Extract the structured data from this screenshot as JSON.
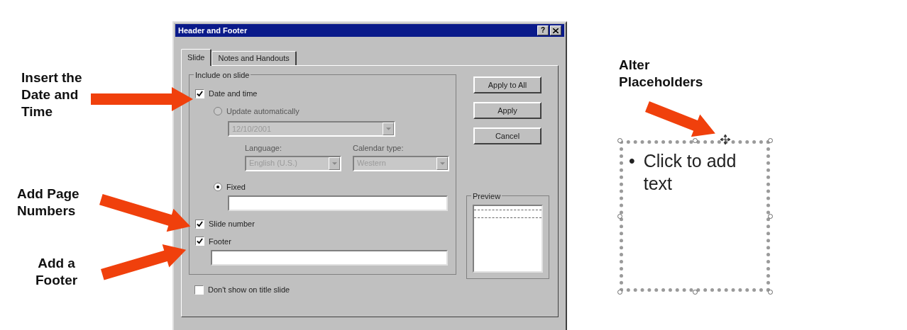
{
  "annotations": [
    {
      "kind": "left",
      "text": "Insert the\nDate and\nTime"
    },
    {
      "kind": "left",
      "text": "Add Page\nNumbers"
    },
    {
      "kind": "center",
      "text": "Add a\nFooter"
    },
    {
      "kind": "left",
      "text": "Alter\nPlaceholders"
    }
  ],
  "dialog": {
    "title": "Header and Footer",
    "help_button": "?",
    "tabs": [
      {
        "label": "Slide",
        "selected": true
      },
      {
        "label": "Notes and Handouts",
        "selected": false
      }
    ],
    "group_title": "Include on slide",
    "date_and_time": {
      "label": "Date and time",
      "checked": true
    },
    "update_automatically": {
      "label": "Update automatically",
      "selected": false,
      "disabled": true,
      "date": "12/10/2001",
      "language_label": "Language:",
      "language": "English (U.S.)",
      "calendar_label": "Calendar type:",
      "calendar": "Western"
    },
    "fixed": {
      "label": "Fixed",
      "selected": true
    },
    "slide_number": {
      "label": "Slide number",
      "checked": true
    },
    "footer": {
      "label": "Footer",
      "checked": true
    },
    "dont_show_on_title_slide": {
      "label": "Don't show on title slide",
      "checked": false
    },
    "buttons": [
      "Apply to All",
      "Apply",
      "Cancel"
    ],
    "preview_title": "Preview"
  },
  "placeholder": {
    "bullet": "•",
    "text": "Click to add text"
  }
}
